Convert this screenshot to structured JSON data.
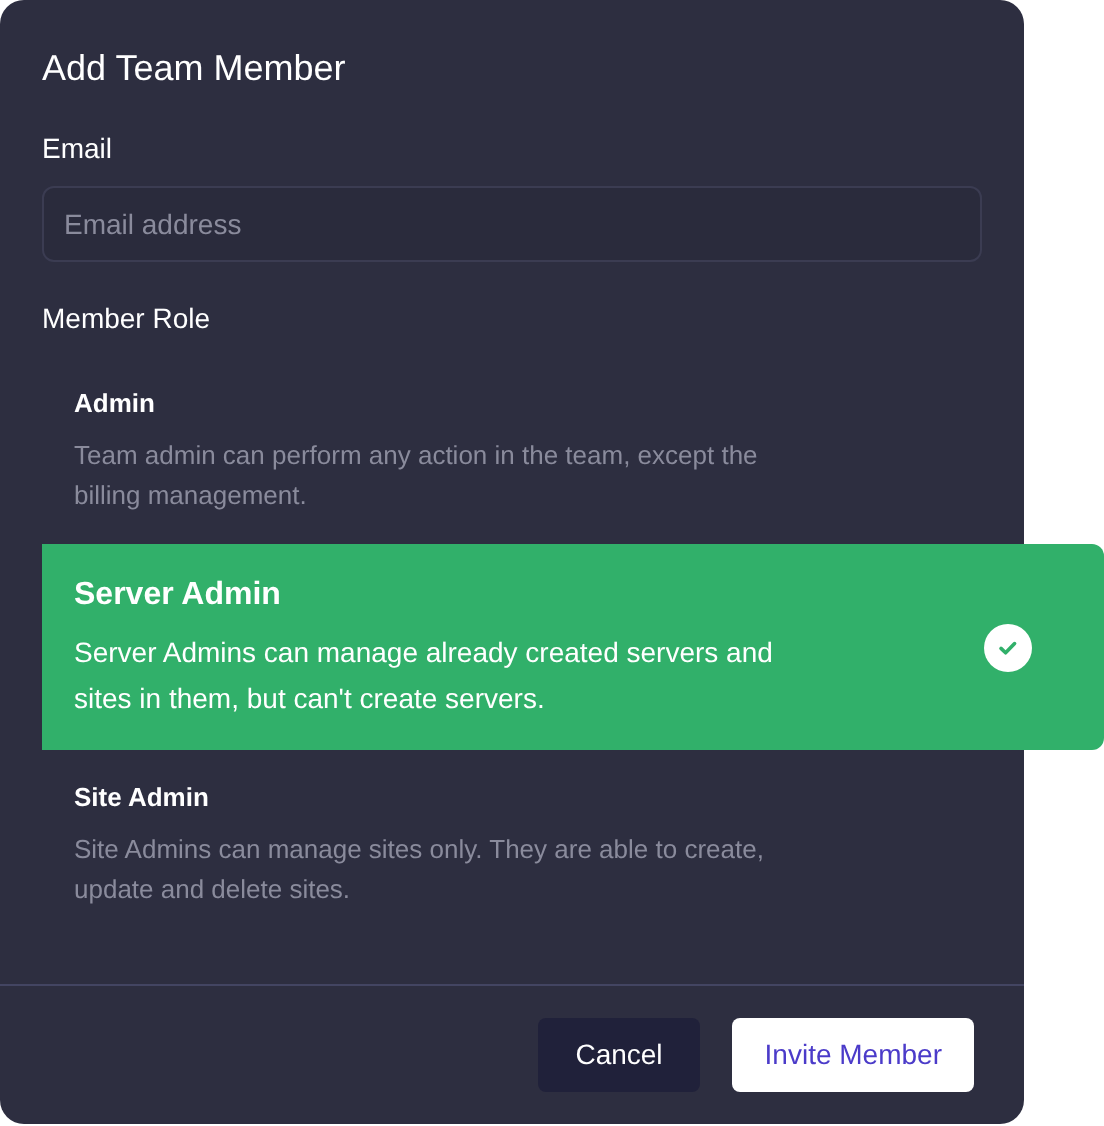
{
  "dialog": {
    "title": "Add Team Member"
  },
  "email": {
    "label": "Email",
    "placeholder": "Email address"
  },
  "role": {
    "label": "Member Role",
    "options": [
      {
        "title": "Admin",
        "description": "Team admin can perform any action in the team, except the billing management.",
        "selected": false
      },
      {
        "title": "Server Admin",
        "description": "Server Admins can manage already created servers and sites in them, but can't create servers.",
        "selected": true
      },
      {
        "title": "Site Admin",
        "description": "Site Admins can manage sites only. They are able to create, update and delete sites.",
        "selected": false
      }
    ]
  },
  "buttons": [
    {
      "label": "Cancel",
      "kind": "secondary"
    },
    {
      "label": "Invite Member",
      "kind": "primary"
    }
  ]
}
